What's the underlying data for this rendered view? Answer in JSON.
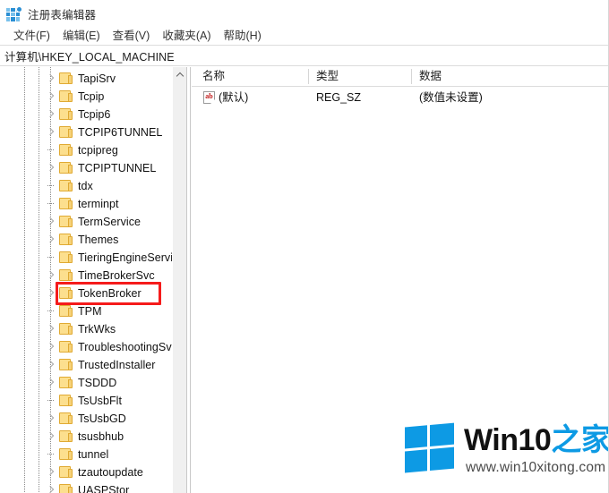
{
  "window": {
    "title": "注册表编辑器",
    "icon": "registry-editor-icon"
  },
  "menubar": {
    "items": [
      {
        "label": "文件(F)",
        "name": "menu-file"
      },
      {
        "label": "编辑(E)",
        "name": "menu-edit"
      },
      {
        "label": "查看(V)",
        "name": "menu-view"
      },
      {
        "label": "收藏夹(A)",
        "name": "menu-favorites"
      },
      {
        "label": "帮助(H)",
        "name": "menu-help"
      }
    ]
  },
  "addressbar": {
    "path": "计算机\\HKEY_LOCAL_MACHINE"
  },
  "tree": {
    "highlighted_node": "TokenBroker",
    "highlight_color": "#f51b1b",
    "nodes": [
      {
        "label": "TapiSrv",
        "expandable": true
      },
      {
        "label": "Tcpip",
        "expandable": true
      },
      {
        "label": "Tcpip6",
        "expandable": true
      },
      {
        "label": "TCPIP6TUNNEL",
        "expandable": true
      },
      {
        "label": "tcpipreg",
        "expandable": false
      },
      {
        "label": "TCPIPTUNNEL",
        "expandable": true
      },
      {
        "label": "tdx",
        "expandable": false
      },
      {
        "label": "terminpt",
        "expandable": false
      },
      {
        "label": "TermService",
        "expandable": true
      },
      {
        "label": "Themes",
        "expandable": true
      },
      {
        "label": "TieringEngineService",
        "expandable": false
      },
      {
        "label": "TimeBrokerSvc",
        "expandable": true
      },
      {
        "label": "TokenBroker",
        "expandable": true
      },
      {
        "label": "TPM",
        "expandable": false
      },
      {
        "label": "TrkWks",
        "expandable": true
      },
      {
        "label": "TroubleshootingSvc",
        "expandable": true
      },
      {
        "label": "TrustedInstaller",
        "expandable": true
      },
      {
        "label": "TSDDD",
        "expandable": true
      },
      {
        "label": "TsUsbFlt",
        "expandable": false
      },
      {
        "label": "TsUsbGD",
        "expandable": true
      },
      {
        "label": "tsusbhub",
        "expandable": true
      },
      {
        "label": "tunnel",
        "expandable": false
      },
      {
        "label": "tzautoupdate",
        "expandable": true
      },
      {
        "label": "UASPStor",
        "expandable": true
      }
    ]
  },
  "list": {
    "columns": [
      {
        "label": "名称",
        "name": "column-name"
      },
      {
        "label": "类型",
        "name": "column-type"
      },
      {
        "label": "数据",
        "name": "column-data"
      }
    ],
    "rows": [
      {
        "icon": "string-value-icon",
        "name": "(默认)",
        "type": "REG_SZ",
        "data": "(数值未设置)"
      }
    ]
  },
  "watermark": {
    "brand_dark": "Win10",
    "brand_blue": "之家",
    "url": "www.win10xitong.com",
    "accent": "#0d9ae4"
  }
}
